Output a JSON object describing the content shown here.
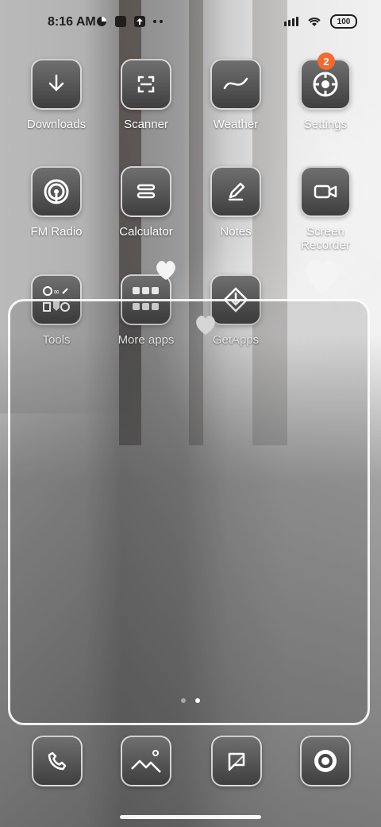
{
  "statusbar": {
    "time": "8:16 AM",
    "battery": "100"
  },
  "apps": [
    {
      "label": "Downloads",
      "icon": "download-icon"
    },
    {
      "label": "Scanner",
      "icon": "scanner-icon"
    },
    {
      "label": "Weather",
      "icon": "weather-icon"
    },
    {
      "label": "Settings",
      "icon": "gear-icon",
      "badge": "2"
    },
    {
      "label": "FM Radio",
      "icon": "radio-icon"
    },
    {
      "label": "Calculator",
      "icon": "calculator-icon"
    },
    {
      "label": "Notes",
      "icon": "notes-icon"
    },
    {
      "label": "Screen\nRecorder",
      "icon": "video-camera-icon"
    },
    {
      "label": "Tools",
      "icon": "folder-icon"
    },
    {
      "label": "More apps",
      "icon": "folder-icon"
    },
    {
      "label": "GetApps",
      "icon": "getapps-icon"
    }
  ],
  "dock": [
    {
      "icon": "phone-icon"
    },
    {
      "icon": "gallery-icon"
    },
    {
      "icon": "messages-icon"
    },
    {
      "icon": "browser-icon"
    }
  ],
  "page_indicator": {
    "count": 2,
    "active": 2
  },
  "colors": {
    "badge": "#f26a2e",
    "tile_top": "#6f6f6f",
    "tile_bottom": "#3f3f3f"
  }
}
